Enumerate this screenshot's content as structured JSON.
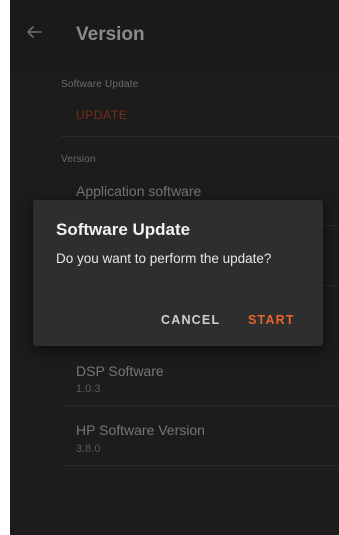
{
  "appbar": {
    "title": "Version"
  },
  "sections": {
    "software_update_header": "Software Update",
    "update_label": "UPDATE",
    "version_header": "Version"
  },
  "items": [
    {
      "title": "Application software",
      "value": ""
    },
    {
      "title": "DSP Software",
      "value": "1.0.3"
    },
    {
      "title": "HP Software Version",
      "value": "3.8.0"
    }
  ],
  "dialog": {
    "title": "Software Update",
    "message": "Do you want to perform the update?",
    "cancel_label": "CANCEL",
    "start_label": "START"
  },
  "colors": {
    "accent": "#e8652a",
    "dialog_bg": "#2e2e2e",
    "appbar_bg": "#1a1a1a",
    "content_bg": "#1c1c1c"
  },
  "icons": {
    "back": "arrow-left-icon"
  }
}
